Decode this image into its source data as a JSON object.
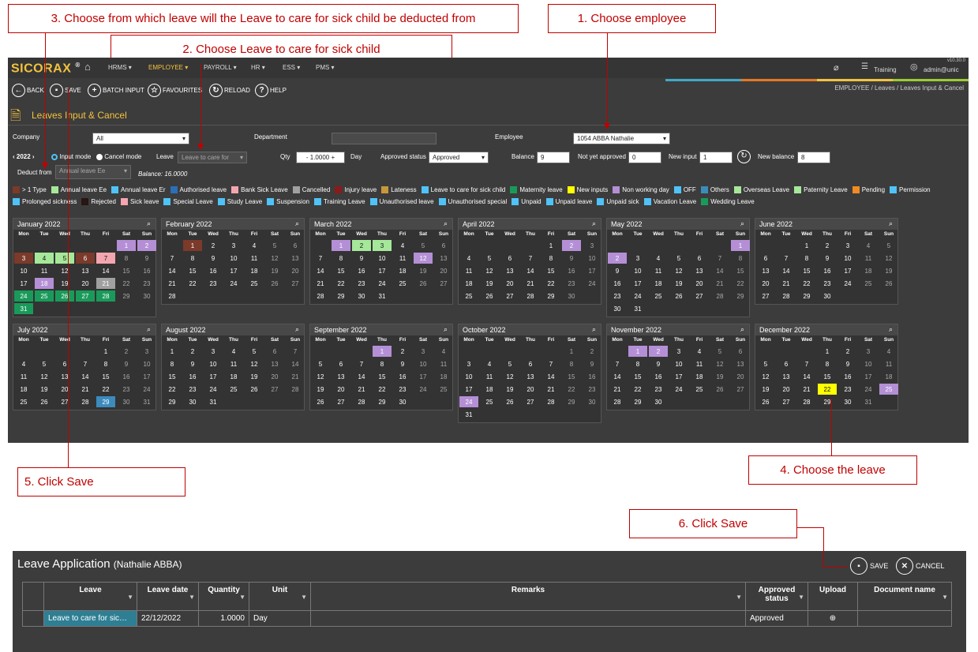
{
  "callouts": {
    "c3": "3.   Choose from which leave will the Leave to care for sick child be deducted from",
    "c2": "2.   Choose Leave to care for sick child",
    "c1": "1.   Choose employee",
    "c4": "4.   Choose the leave",
    "c5": "5. Click Save",
    "c6": "6.   Click Save"
  },
  "app": {
    "logo": "SICORAX",
    "version": "v10.30.0",
    "menu": [
      "HRMS ▾",
      "EMPLOYEE ▾",
      "PAYROLL ▾",
      "HR ▾",
      "ESS ▾",
      "PMS ▾"
    ],
    "training": "Training",
    "user": "admin@unic",
    "toolbar": {
      "back": "BACK",
      "save": "SAVE",
      "batch": "BATCH INPUT",
      "fav": "FAVOURITES",
      "reload": "RELOAD",
      "help": "HELP"
    },
    "breadcrumb": "EMPLOYEE /  Leaves /  Leaves Input & Cancel",
    "page_title": "Leaves Input & Cancel"
  },
  "form": {
    "company_label": "Company",
    "company_value": "All",
    "department_label": "Department",
    "employee_label": "Employee",
    "employee_value": "1054 ABBA Nathalie",
    "year": "2022",
    "input_mode": "Input mode",
    "cancel_mode": "Cancel mode",
    "leave_label": "Leave",
    "leave_value": "Leave to care for",
    "qty_label": "Qty",
    "qty_value": "1.0000",
    "day_label": "Day",
    "approved_label": "Approved status",
    "approved_value": "Approved",
    "balance_label": "Balance",
    "balance_value": "9",
    "nya_label": "Not yet approved",
    "nya_value": "0",
    "newinput_label": "New input",
    "newinput_value": "1",
    "newbal_label": "New balance",
    "newbal_value": "8",
    "deduct_label": "Deduct from",
    "deduct_value": "Annual leave Ee",
    "deduct_balance": "Balance: 16.0000"
  },
  "legend": [
    {
      "label": "> 1 Type",
      "color": "#7b3a2a"
    },
    {
      "label": "Annual leave Ee",
      "color": "#a6e89a"
    },
    {
      "label": "Annual leave Er",
      "color": "#4fc3f7"
    },
    {
      "label": "Authorised leave",
      "color": "#2b6fb6"
    },
    {
      "label": "Bank Sick Leave",
      "color": "#f4a6b0"
    },
    {
      "label": "Cancelled",
      "color": "#a0a0a0"
    },
    {
      "label": "Injury leave",
      "color": "#8b1a1a"
    },
    {
      "label": "Lateness",
      "color": "#c8993a"
    },
    {
      "label": "Leave to care for sick child",
      "color": "#4fc3f7"
    },
    {
      "label": "Maternity leave",
      "color": "#1a9a5a"
    },
    {
      "label": "New inputs",
      "color": "#ffff00"
    },
    {
      "label": "Non working day",
      "color": "#b48fd6"
    },
    {
      "label": "OFF",
      "color": "#4fc3f7"
    },
    {
      "label": "Others",
      "color": "#3c8bbd"
    },
    {
      "label": "Overseas Leave",
      "color": "#a6e89a"
    },
    {
      "label": "Paternity Leave",
      "color": "#a6e89a"
    },
    {
      "label": "Pending",
      "color": "#f08a24"
    },
    {
      "label": "Permission",
      "color": "#4fc3f7"
    },
    {
      "label": "Prolonged sickness",
      "color": "#4fc3f7"
    },
    {
      "label": "Rejected",
      "color": "#2a1414"
    },
    {
      "label": "Sick leave",
      "color": "#f4a6b0"
    },
    {
      "label": "Special Leave",
      "color": "#4fc3f7"
    },
    {
      "label": "Study Leave",
      "color": "#4fc3f7"
    },
    {
      "label": "Suspension",
      "color": "#4fc3f7"
    },
    {
      "label": "Training Leave",
      "color": "#4fc3f7"
    },
    {
      "label": "Unauthorised leave",
      "color": "#4fc3f7"
    },
    {
      "label": "Unauthorised special",
      "color": "#4fc3f7"
    },
    {
      "label": "Unpaid",
      "color": "#4fc3f7"
    },
    {
      "label": "Unpaid leave",
      "color": "#4fc3f7"
    },
    {
      "label": "Unpaid sick",
      "color": "#4fc3f7"
    },
    {
      "label": "Vacation Leave",
      "color": "#4fc3f7"
    },
    {
      "label": "Wedding Leave",
      "color": "#1a9a5a"
    }
  ],
  "dow": [
    "Mon",
    "Tue",
    "Wed",
    "Thu",
    "Fri",
    "Sat",
    "Sun"
  ],
  "months": [
    {
      "name": "January 2022",
      "start": 5,
      "days": 31,
      "marks": {
        "1": "#b48fd6",
        "2": "#b48fd6",
        "3": "#7b3a2a",
        "4": "#a6e89a",
        "5": "#a6e89a",
        "6": "#7b3a2a",
        "7": "#f4a6b0",
        "18": "#b48fd6",
        "21": "#a0a0a0",
        "24": "#1a9a5a",
        "25": "#1a9a5a",
        "26": "#1a9a5a",
        "27": "#1a9a5a",
        "28": "#1a9a5a",
        "31": "#1a9a5a"
      }
    },
    {
      "name": "February 2022",
      "start": 1,
      "days": 28,
      "marks": {
        "1": "#7b3a2a"
      }
    },
    {
      "name": "March 2022",
      "start": 1,
      "days": 31,
      "marks": {
        "1": "#b48fd6",
        "2": "#a6e89a",
        "3": "#a6e89a",
        "12": "#b48fd6"
      }
    },
    {
      "name": "April 2022",
      "start": 4,
      "days": 30,
      "marks": {
        "2": "#b48fd6"
      }
    },
    {
      "name": "May 2022",
      "start": 6,
      "days": 31,
      "marks": {
        "1": "#b48fd6",
        "2": "#b48fd6"
      }
    },
    {
      "name": "June 2022",
      "start": 2,
      "days": 30,
      "marks": {}
    },
    {
      "name": "July 2022",
      "start": 4,
      "days": 31,
      "marks": {
        "29": "#3c8bbd"
      }
    },
    {
      "name": "August 2022",
      "start": 0,
      "days": 31,
      "marks": {}
    },
    {
      "name": "September 2022",
      "start": 3,
      "days": 30,
      "marks": {
        "1": "#b48fd6"
      }
    },
    {
      "name": "October 2022",
      "start": 5,
      "days": 31,
      "marks": {
        "24": "#b48fd6"
      }
    },
    {
      "name": "November 2022",
      "start": 1,
      "days": 30,
      "marks": {
        "1": "#b48fd6",
        "2": "#b48fd6"
      }
    },
    {
      "name": "December 2022",
      "start": 3,
      "days": 31,
      "marks": {
        "22": "#ffff00",
        "25": "#b48fd6"
      }
    }
  ],
  "leave_app": {
    "title": "Leave Application",
    "subtitle": "(Nathalie ABBA)",
    "save": "SAVE",
    "cancel": "CANCEL",
    "columns": [
      "Leave",
      "Leave date",
      "Quantity",
      "Unit",
      "Remarks",
      "Approved status",
      "Upload",
      "Document name"
    ],
    "row": {
      "leave": "Leave to care for sic…",
      "date": "22/12/2022",
      "qty": "1.0000",
      "unit": "Day",
      "remarks": "",
      "status": "Approved",
      "doc": ""
    }
  }
}
